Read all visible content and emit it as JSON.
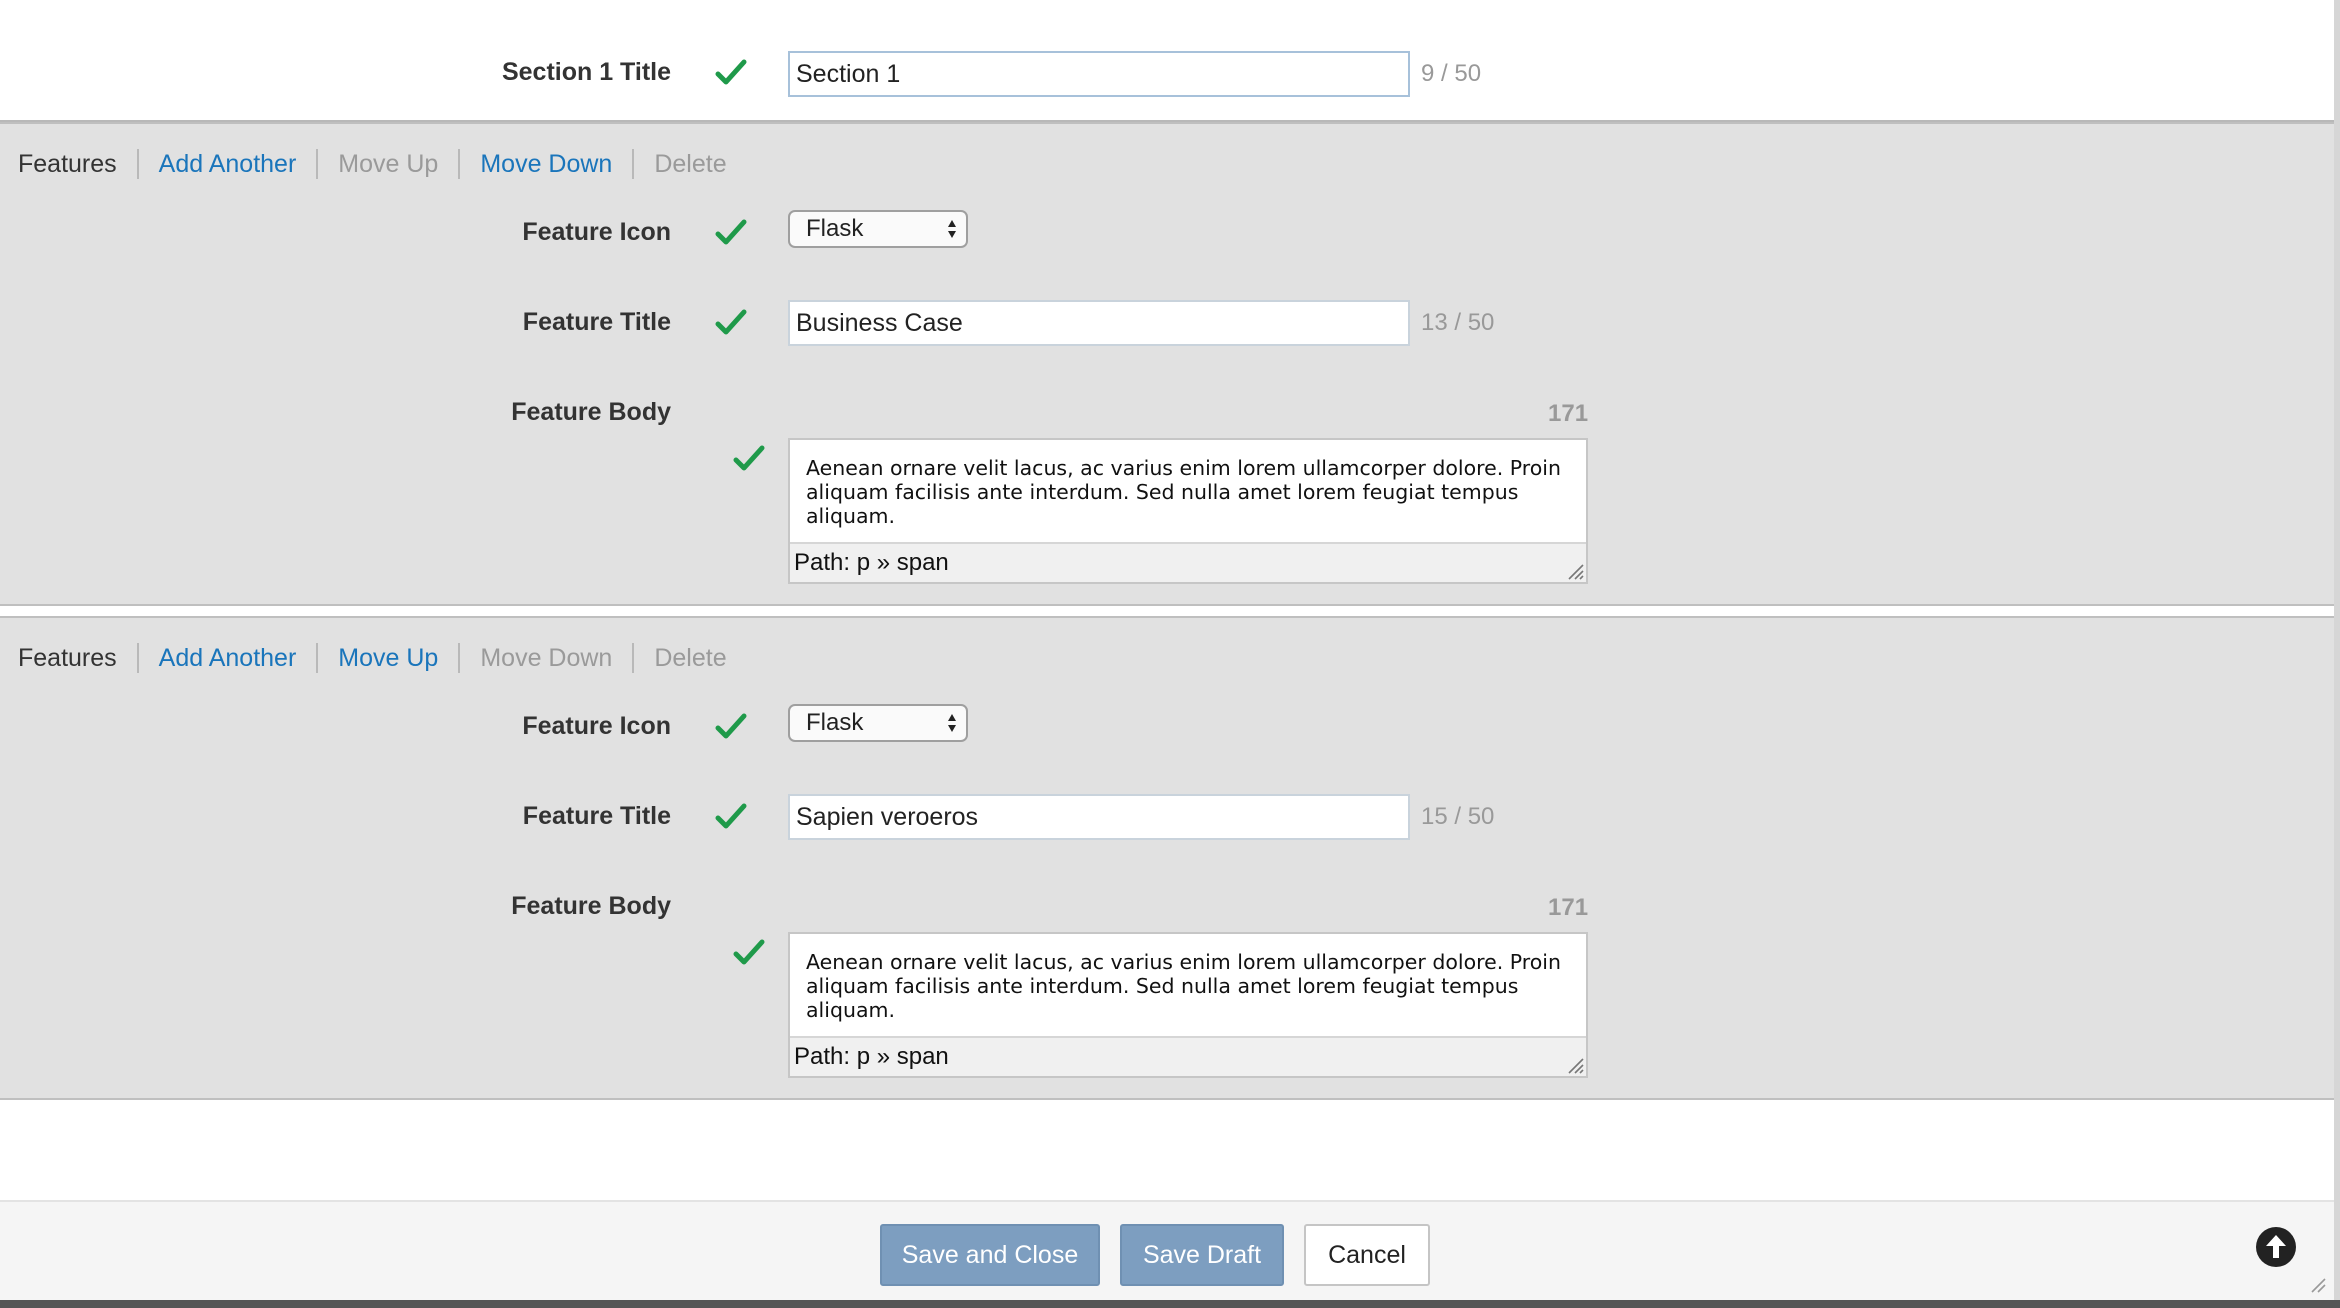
{
  "section_title": {
    "label": "Section 1 Title",
    "value": "Section 1",
    "counter": "9 / 50"
  },
  "features": [
    {
      "toolbar": {
        "label": "Features",
        "add_another": "Add Another",
        "move_up": "Move Up",
        "move_down": "Move Down",
        "delete": "Delete",
        "move_up_enabled": false,
        "move_down_enabled": true,
        "delete_enabled": false
      },
      "icon_label": "Feature Icon",
      "icon_value": "Flask",
      "title_label": "Feature Title",
      "title_value": "Business Case",
      "title_counter": "13 / 50",
      "body_label": "Feature Body",
      "body_count": "171",
      "body_text": "Aenean ornare velit lacus, ac varius enim lorem ullamcorper dolore. Proin aliquam facilisis ante interdum. Sed nulla amet lorem feugiat tempus aliquam.",
      "body_path": "Path: p » span"
    },
    {
      "toolbar": {
        "label": "Features",
        "add_another": "Add Another",
        "move_up": "Move Up",
        "move_down": "Move Down",
        "delete": "Delete",
        "move_up_enabled": true,
        "move_down_enabled": false,
        "delete_enabled": false
      },
      "icon_label": "Feature Icon",
      "icon_value": "Flask",
      "title_label": "Feature Title",
      "title_value": "Sapien veroeros",
      "title_counter": "15 / 50",
      "body_label": "Feature Body",
      "body_count": "171",
      "body_text": "Aenean ornare velit lacus, ac varius enim lorem ullamcorper dolore. Proin aliquam facilisis ante interdum. Sed nulla amet lorem feugiat tempus aliquam.",
      "body_path": "Path: p » span"
    }
  ],
  "footer": {
    "save_close_label": "Save and Close",
    "save_draft_label": "Save Draft",
    "cancel_label": "Cancel"
  },
  "colors": {
    "link": "#1a75bb",
    "disabled": "#9a9a9a",
    "valid_check": "#1f9a4a",
    "primary_button": "#7d9ec0",
    "panel_bg": "#e1e1e1"
  },
  "icons": {
    "valid": "checkmark-icon",
    "select_arrows": "updown-arrows-icon",
    "resize": "resize-grip-icon",
    "back_to_top": "arrow-up-circle-icon"
  }
}
